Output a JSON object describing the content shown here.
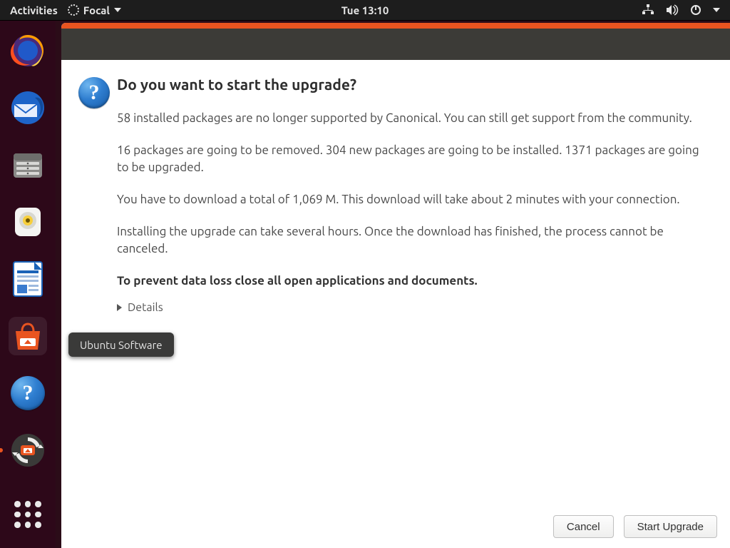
{
  "topbar": {
    "activities": "Activities",
    "app_menu_label": "Focal",
    "clock": "Tue 13:10"
  },
  "dock": {
    "items": [
      {
        "name": "firefox"
      },
      {
        "name": "thunderbird"
      },
      {
        "name": "files"
      },
      {
        "name": "rhythmbox"
      },
      {
        "name": "libreoffice-writer"
      },
      {
        "name": "ubuntu-software",
        "selected": true
      },
      {
        "name": "help"
      },
      {
        "name": "software-updater",
        "running": true
      }
    ],
    "tooltip": "Ubuntu Software"
  },
  "dialog": {
    "title": "Do you want to start the upgrade?",
    "para1": "58 installed packages are no longer supported by Canonical. You can still get support from the community.",
    "para2": "16 packages are going to be removed. 304 new packages are going to be installed. 1371 packages are going to be upgraded.",
    "para3": "You have to download a total of 1,069 M. This download will take about 2 minutes with your connection.",
    "para4": "Installing the upgrade can take several hours. Once the download has finished, the process cannot be canceled.",
    "para_strong": "To prevent data loss close all open applications and documents.",
    "details_label": "Details",
    "buttons": {
      "cancel": "Cancel",
      "start": "Start Upgrade"
    }
  }
}
